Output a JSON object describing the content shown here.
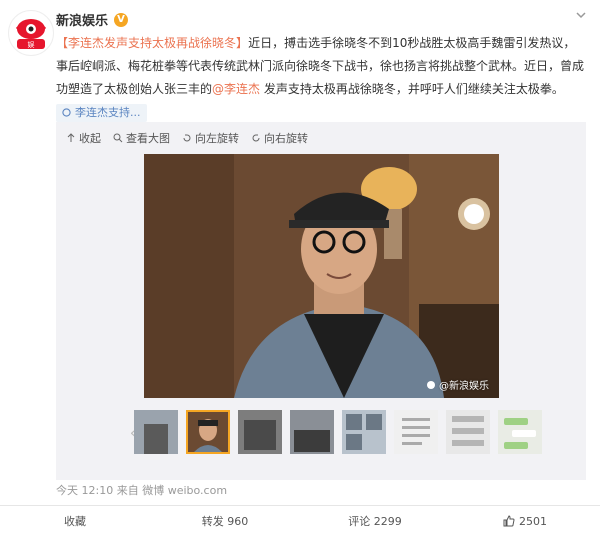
{
  "header": {
    "author": "新浪娱乐",
    "verified_icon": "verified-badge-icon",
    "more_icon": "chevron-down-icon"
  },
  "post": {
    "title_open": "【",
    "title_link": "李连杰发声支持太极再战",
    "title_name": "徐晓冬",
    "title_close": "】",
    "body_1": "近日，搏击选手徐晓冬不到10秒战胜太极高手魏雷引发热议，事后崆峒派、梅花桩拳等代表传统武林门派向徐晓冬下战书，徐也扬言将挑战整个武林。近日，曾成功塑造了太极创始人张三丰的",
    "mention": "@李连杰",
    "body_2": " 发声支持太极再战徐晓冬，并呼吁人们继续关注太极拳。",
    "tag_label": "李连杰支持...",
    "time": "今天 12:10",
    "source_prefix": "来自",
    "source": "微博 weibo.com"
  },
  "toolbar": {
    "collect": "收起",
    "view_large": "查看大图",
    "rotate_left": "向左旋转",
    "rotate_right": "向右旋转"
  },
  "watermark": "@新浪娱乐",
  "actions": {
    "favorite": "收藏",
    "repost": "转发 960",
    "comment": "评论 2299",
    "like": "2501"
  },
  "colors": {
    "accent": "#eb7350",
    "verified": "#f5a623",
    "thumb_active": "#f5a623"
  }
}
